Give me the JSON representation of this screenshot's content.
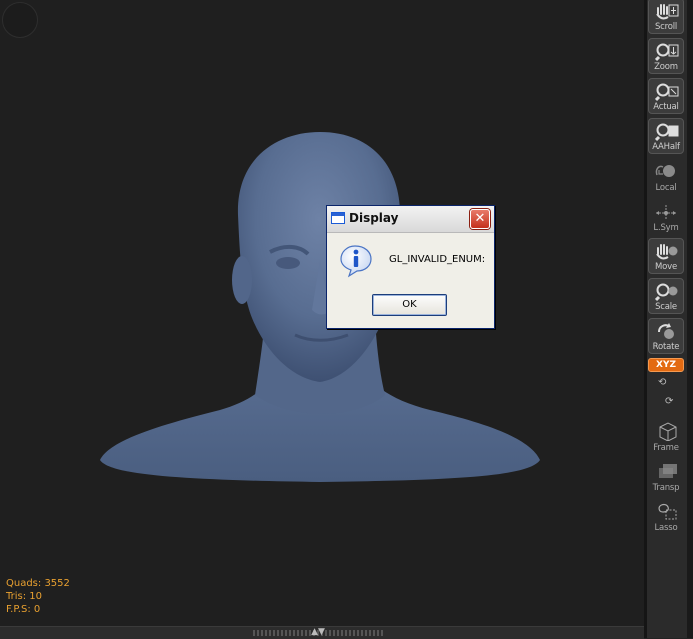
{
  "stats": {
    "quads": "Quads: 3552",
    "tris": "Tris: 10",
    "fps": "F.P.S: 0"
  },
  "dialog": {
    "title": "Display",
    "message": "GL_INVALID_ENUM:",
    "ok_label": "OK",
    "close_glyph": "✕",
    "icon": "info-icon"
  },
  "shelf": {
    "tools": [
      {
        "label": "Scroll",
        "icon": "hand-scroll-icon"
      },
      {
        "label": "Zoom",
        "icon": "magnifier-zoom-icon"
      },
      {
        "label": "Actual",
        "icon": "magnifier-actual-icon"
      },
      {
        "label": "AAHalf",
        "icon": "magnifier-aahalf-icon"
      },
      {
        "label": "Local",
        "icon": "local-sphere-icon"
      },
      {
        "label": "L.Sym",
        "icon": "local-symmetry-icon"
      },
      {
        "label": "Move",
        "icon": "hand-move-icon"
      },
      {
        "label": "Scale",
        "icon": "magnifier-scale-icon"
      },
      {
        "label": "Rotate",
        "icon": "rotate-icon"
      },
      {
        "label": "Frame",
        "icon": "frame-cube-icon"
      },
      {
        "label": "Transp",
        "icon": "transparency-icon"
      },
      {
        "label": "Lasso",
        "icon": "lasso-icon"
      }
    ],
    "xyz_label": "XYZ",
    "accent": "#e36a12"
  },
  "colors": {
    "background": "#1f1f1f",
    "model": "#5a6f93",
    "stats_text": "#e8a030"
  }
}
